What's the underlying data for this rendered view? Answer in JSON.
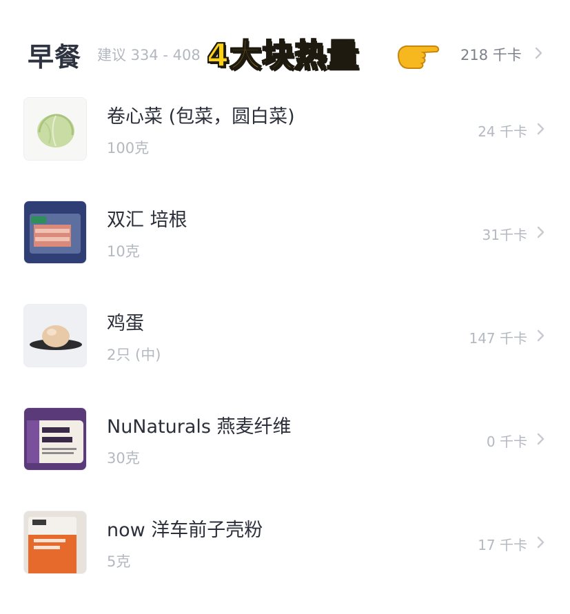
{
  "meal": {
    "title": "早餐",
    "suggestion": "建议 334 - 408",
    "total": "218 千卡"
  },
  "overlay_caption": "4大块热量",
  "items": [
    {
      "name": "卷心菜 (包菜，圆白菜)",
      "amount": "100克",
      "kcal": "24 千卡",
      "image_icon": "cabbage-thumbnail"
    },
    {
      "name": "双汇 培根",
      "amount": "10克",
      "kcal": "31千卡",
      "image_icon": "bacon-package-thumbnail"
    },
    {
      "name": "鸡蛋",
      "amount": "2只 (中)",
      "kcal": "147 千卡",
      "image_icon": "egg-thumbnail"
    },
    {
      "name": "NuNaturals 燕麦纤维",
      "amount": "30克",
      "kcal": "0 千卡",
      "image_icon": "oat-fiber-package-thumbnail"
    },
    {
      "name": "now 洋车前子壳粉",
      "amount": "5克",
      "kcal": "17 千卡",
      "image_icon": "psyllium-package-thumbnail"
    }
  ],
  "colors": {
    "title": "#2e3340",
    "secondary_text": "#b4b8c1",
    "overlay_fill": "#ffd21a",
    "overlay_stroke": "#1e1a10"
  }
}
